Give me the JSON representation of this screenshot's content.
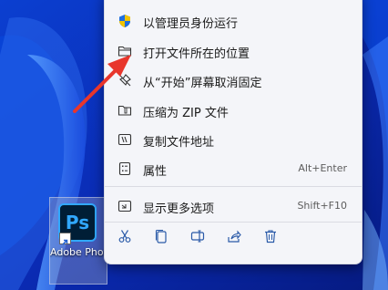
{
  "context_menu": {
    "items": [
      {
        "label": "以管理员身份运行",
        "icon": "shield-icon"
      },
      {
        "label": "打开文件所在的位置",
        "icon": "folder-icon"
      },
      {
        "label": "从“开始”屏幕取消固定",
        "icon": "unpin-icon"
      },
      {
        "label": "压缩为 ZIP 文件",
        "icon": "zip-folder-icon"
      },
      {
        "label": "复制文件地址",
        "icon": "copy-path-icon"
      },
      {
        "label": "属性",
        "icon": "properties-icon",
        "shortcut": "Alt+Enter"
      },
      {
        "label": "显示更多选项",
        "icon": "more-options-icon",
        "shortcut": "Shift+F10"
      }
    ],
    "actions": [
      "cut-icon",
      "copy-icon",
      "rename-icon",
      "share-icon",
      "delete-icon"
    ]
  },
  "desktop": {
    "shortcut_label": "Adobe Photosh..."
  },
  "app_icon_text": "Ps",
  "colors": {
    "wallpaper": "#0a2bb0",
    "menu_bg": "#f4f5f9",
    "accent_arrow": "#e8362c",
    "ps_blue": "#31a8ff"
  }
}
